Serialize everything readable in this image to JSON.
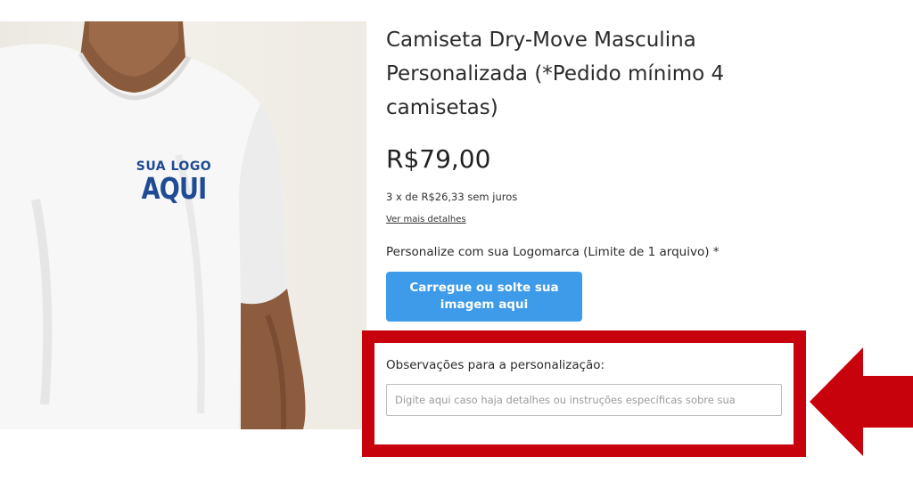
{
  "product": {
    "logo_print": {
      "line1": "SUA LOGO",
      "line2": "AQUI"
    },
    "title": "Camiseta Dry-Move Masculina Personalizada (*Pedido mínimo 4 camisetas)",
    "price": "R$79,00",
    "installments": "3 x de R$26,33 sem juros",
    "details_link": "Ver mais detalhes"
  },
  "customization": {
    "logo_label": "Personalize com sua Logomarca (Limite de 1 arquivo) *",
    "upload_button": "Carregue ou solte sua imagem aqui",
    "notes_label": "Observações para a personalização:",
    "notes_placeholder": "Digite aqui caso haja detalhes ou instruções específicas sobre sua",
    "notes_value": ""
  },
  "colors": {
    "highlight": "#c8020c",
    "upload_button_bg": "#3d9be9",
    "logo_print": "#1f4a94"
  },
  "icons": {
    "pointer": "left-arrow-icon"
  }
}
